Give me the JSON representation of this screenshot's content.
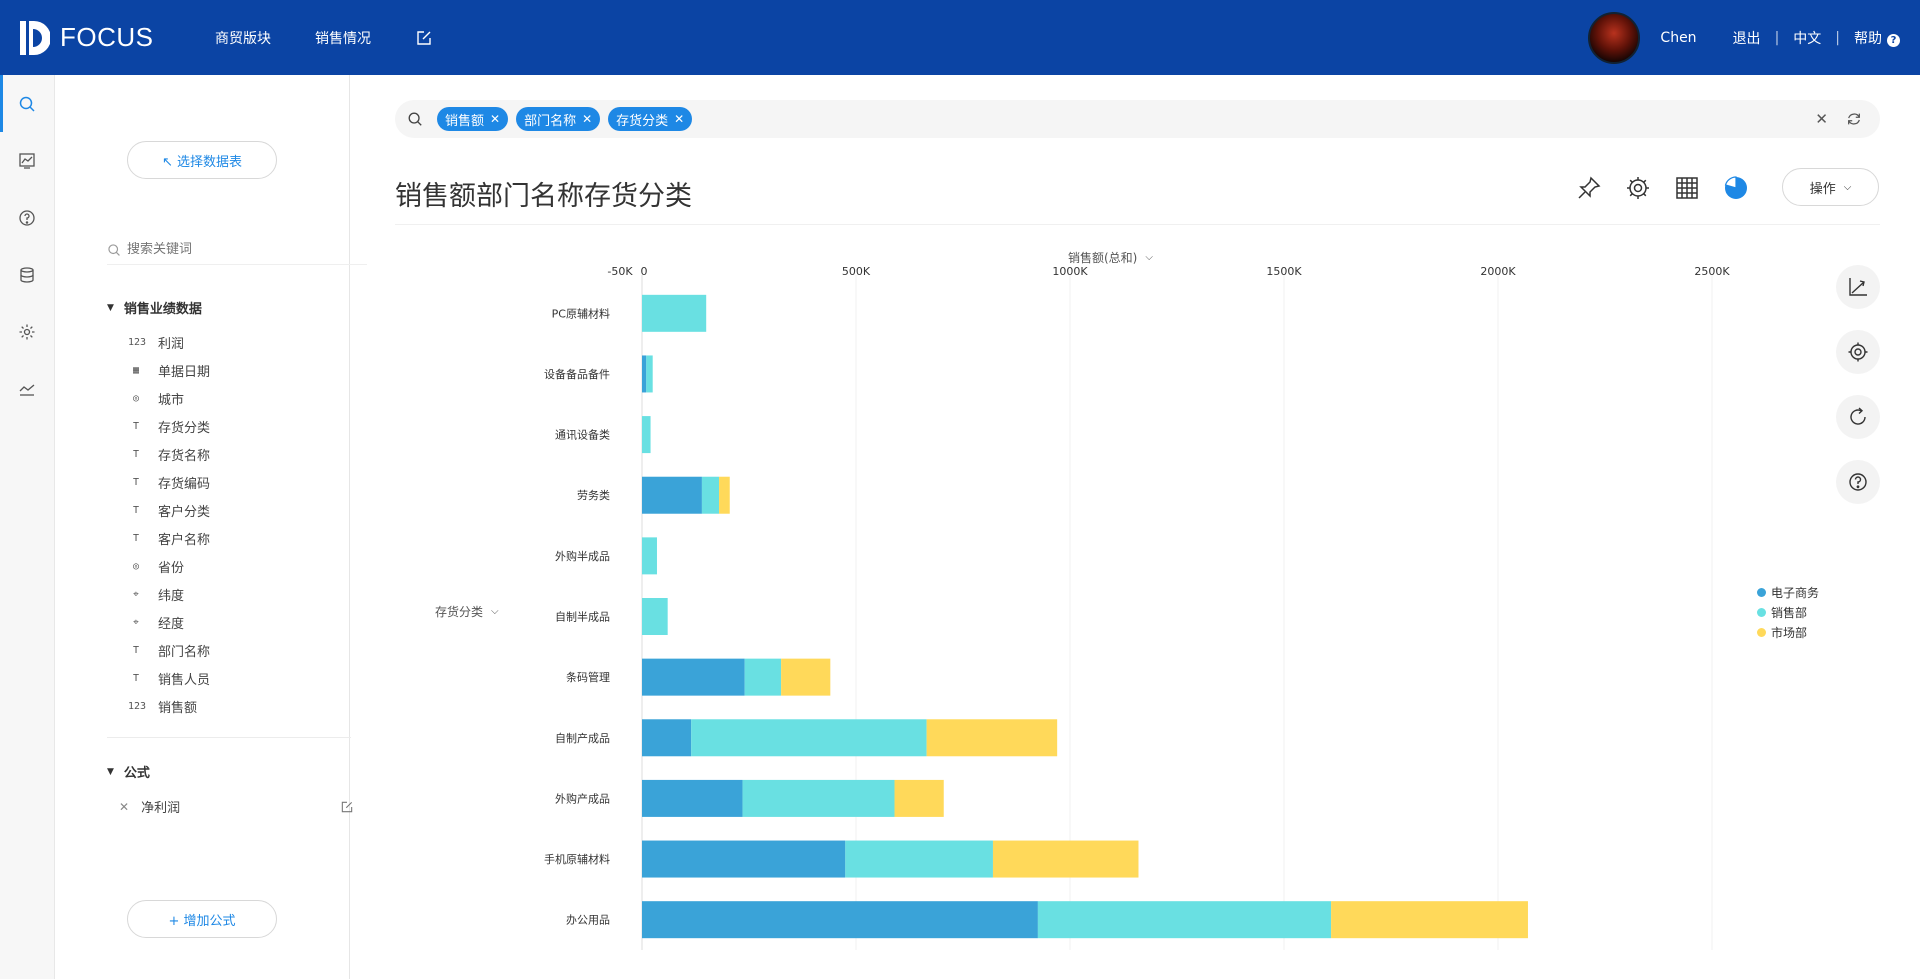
{
  "app": {
    "brand": "FOCUS"
  },
  "nav": [
    {
      "label": "商贸版块"
    },
    {
      "label": "销售情况"
    }
  ],
  "user": {
    "name": "Chen",
    "logout": "退出",
    "lang": "中文",
    "help": "帮助"
  },
  "panel": {
    "choose_table": "↖ 选择数据表",
    "search_placeholder": "搜索关键词",
    "group_title": "销售业绩数据",
    "fields": [
      {
        "type": "123",
        "label": "利润"
      },
      {
        "type": "date",
        "label": "单据日期"
      },
      {
        "type": "geo",
        "label": "城市"
      },
      {
        "type": "text",
        "label": "存货分类"
      },
      {
        "type": "text",
        "label": "存货名称"
      },
      {
        "type": "text",
        "label": "存货编码"
      },
      {
        "type": "text",
        "label": "客户分类"
      },
      {
        "type": "text",
        "label": "客户名称"
      },
      {
        "type": "geo",
        "label": "省份"
      },
      {
        "type": "map",
        "label": "纬度"
      },
      {
        "type": "map",
        "label": "经度"
      },
      {
        "type": "text",
        "label": "部门名称"
      },
      {
        "type": "text",
        "label": "销售人员"
      },
      {
        "type": "123",
        "label": "销售额"
      }
    ],
    "formula_title": "公式",
    "formula_item": "净利润",
    "add_formula": "+ 增加公式"
  },
  "search": {
    "chips": [
      "销售额",
      "部门名称",
      "存货分类"
    ]
  },
  "page_title": "销售额部门名称存货分类",
  "operation_label": "操作",
  "colors": {
    "topbar": "#0b44a4",
    "accent": "#1e88e5",
    "series1": "#3aa3d8",
    "series2": "#69e0e2",
    "series3": "#ffd95a"
  },
  "chart_data": {
    "type": "bar",
    "orientation": "horizontal",
    "stacked": true,
    "xlabel": "销售额(总和)",
    "ylabel": "存货分类",
    "x_ticks": [
      "-50K",
      "0",
      "500K",
      "1000K",
      "1500K",
      "2000K",
      "2500K"
    ],
    "xlim": [
      -50000,
      2650000
    ],
    "categories": [
      "PC原辅材料",
      "设备备品备件",
      "通讯设备类",
      "劳务类",
      "外购半成品",
      "自制半成品",
      "条码管理",
      "自制产成品",
      "外购产成品",
      "手机原辅材料",
      "办公用品"
    ],
    "series": [
      {
        "name": "电子商务",
        "color": "#3aa3d8",
        "values": [
          0,
          10000,
          0,
          140000,
          0,
          0,
          240000,
          115000,
          235000,
          475000,
          925000
        ]
      },
      {
        "name": "销售部",
        "color": "#69e0e2",
        "values": [
          150000,
          15000,
          20000,
          40000,
          35000,
          60000,
          85000,
          550000,
          355000,
          345000,
          685000
        ]
      },
      {
        "name": "市场部",
        "color": "#ffd95a",
        "values": [
          0,
          0,
          0,
          25000,
          0,
          0,
          115000,
          305000,
          115000,
          340000,
          460000
        ]
      }
    ],
    "legend_position": "right",
    "grid": true
  }
}
